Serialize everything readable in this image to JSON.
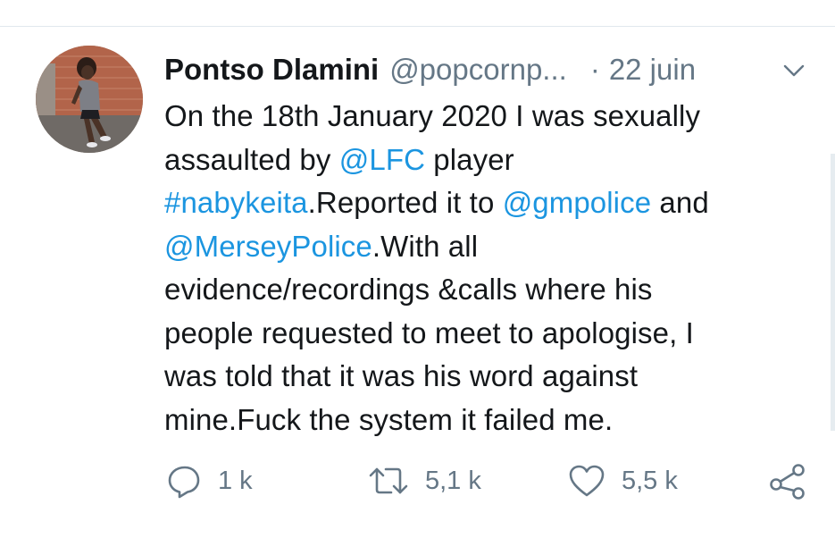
{
  "tweet": {
    "author_name": "Pontso Dlamini",
    "author_handle": "@popcornp...",
    "separator": "·",
    "date": "22 juin",
    "lines": [
      [
        {
          "text": "On the 18th January 2020 I was sexually",
          "link": false
        }
      ],
      [
        {
          "text": "assaulted by ",
          "link": false
        },
        {
          "text": "@LFC",
          "link": true
        },
        {
          "text": " player",
          "link": false
        }
      ],
      [
        {
          "text": "#nabykeita",
          "link": true
        },
        {
          "text": ".Reported it to ",
          "link": false
        },
        {
          "text": "@gmpolice",
          "link": true
        },
        {
          "text": " and",
          "link": false
        }
      ],
      [
        {
          "text": "@MerseyPolice",
          "link": true
        },
        {
          "text": ".With all",
          "link": false
        }
      ],
      [
        {
          "text": "evidence/recordings &calls where his",
          "link": false
        }
      ],
      [
        {
          "text": "people requested to meet to apologise, I",
          "link": false
        }
      ],
      [
        {
          "text": "was told that it was his word against",
          "link": false
        }
      ],
      [
        {
          "text": "mine.Fuck the system it failed me.",
          "link": false
        }
      ]
    ]
  },
  "actions": {
    "reply_count": "1 k",
    "retweet_count": "5,1 k",
    "like_count": "5,5 k"
  },
  "icons": {
    "caret": "chevron-down-icon",
    "reply": "reply-icon",
    "retweet": "retweet-icon",
    "like": "heart-icon",
    "share": "share-icon"
  },
  "colors": {
    "link": "#1b95e0",
    "secondary": "#657786",
    "text": "#14171a"
  }
}
